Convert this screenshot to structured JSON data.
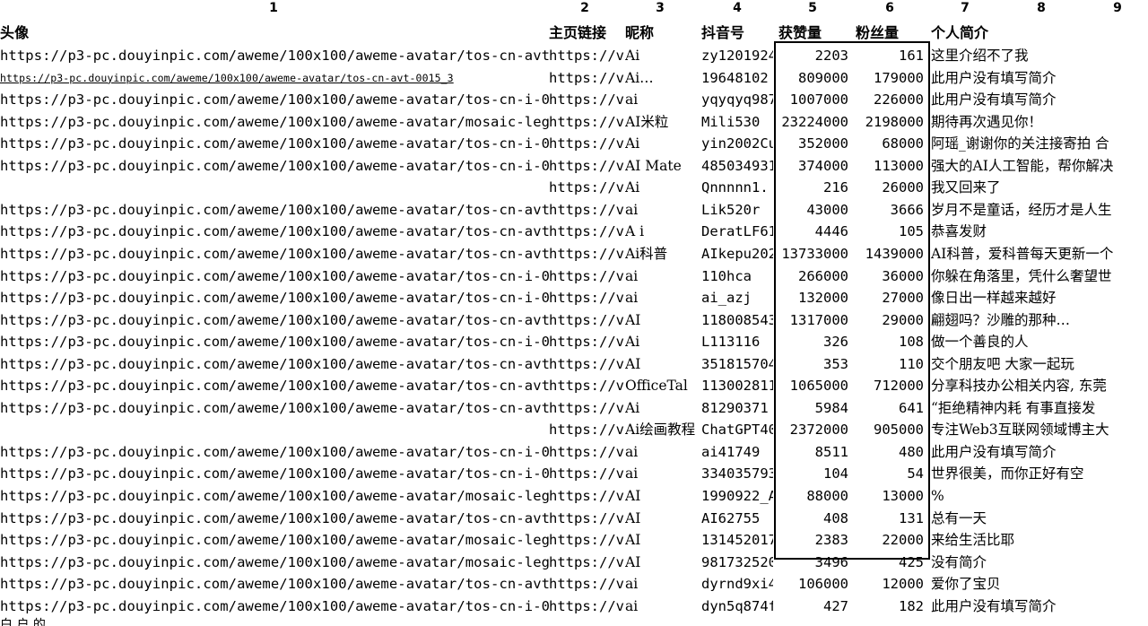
{
  "column_numbers": [
    "1",
    "2",
    "3",
    "4",
    "5",
    "6",
    "7",
    "8",
    "9"
  ],
  "headers": {
    "avatar": "头像",
    "homepage": "主页链接",
    "nickname": "昵称",
    "douyin_id": "抖音号",
    "likes": "获赞量",
    "followers": "粉丝量",
    "bio": "个人简介"
  },
  "rows": [
    {
      "avatar": "https://p3-pc.douyinpic.com/aweme/100x100/aweme-avatar/tos-cn-avt-0015_3",
      "homepage": "https://v",
      "nickname": "Ai",
      "douyin_id": "zy1201924",
      "likes": "2203",
      "followers": "161",
      "bio": "这里介绍不了我"
    },
    {
      "avatar": "https://p3-pc.douyinpic.com/aweme/100x100/aweme-avatar/tos-cn-avt-0015_3",
      "homepage": "https://v",
      "nickname": "Ai…",
      "douyin_id": "19648102",
      "likes": "809000",
      "followers": "179000",
      "bio": "此用户没有填写简介"
    },
    {
      "avatar": "https://p3-pc.douyinpic.com/aweme/100x100/aweme-avatar/tos-cn-i-0813",
      "homepage": "https://v",
      "nickname": "ai",
      "douyin_id": "yqyqyq987",
      "likes": "1007000",
      "followers": "226000",
      "bio": "此用户没有填写简介"
    },
    {
      "avatar": "https://p3-pc.douyinpic.com/aweme/100x100/aweme-avatar/mosaic-legacy",
      "homepage": "https://v",
      "nickname": "AI米粒",
      "douyin_id": "Mili530",
      "likes": "23224000",
      "followers": "2198000",
      "bio": "期待再次遇见你！"
    },
    {
      "avatar": "https://p3-pc.douyinpic.com/aweme/100x100/aweme-avatar/tos-cn-i-0813",
      "homepage": "https://v",
      "nickname": "Ai",
      "douyin_id": "yin2002Cu",
      "likes": "352000",
      "followers": "68000",
      "bio": "阿瑶_谢谢你的关注接寄拍 合"
    },
    {
      "avatar": "https://p3-pc.douyinpic.com/aweme/100x100/aweme-avatar/tos-cn-i-0813",
      "homepage": "https://v",
      "nickname": "AI Mate",
      "douyin_id": "485034931",
      "likes": "374000",
      "followers": "113000",
      "bio": "强大的AI人工智能，帮你解决"
    },
    {
      "avatar": "",
      "homepage": "https://v",
      "nickname": "Ai",
      "douyin_id": "Qnnnnn1.",
      "likes": "216",
      "followers": "26000",
      "bio": "我又回来了"
    },
    {
      "avatar": "https://p3-pc.douyinpic.com/aweme/100x100/aweme-avatar/tos-cn-avt-0015",
      "homepage": "https://v",
      "nickname": "ai",
      "douyin_id": "Lik520r",
      "likes": "43000",
      "followers": "3666",
      "bio": "岁月不是童话，经历才是人生"
    },
    {
      "avatar": "https://p3-pc.douyinpic.com/aweme/100x100/aweme-avatar/tos-cn-avt-0015",
      "homepage": "https://v",
      "nickname": "A i",
      "douyin_id": "DeratLF61",
      "likes": "4446",
      "followers": "105",
      "bio": "恭喜发财"
    },
    {
      "avatar": "https://p3-pc.douyinpic.com/aweme/100x100/aweme-avatar/tos-cn-avt-0015",
      "homepage": "https://v",
      "nickname": "Ai科普",
      "douyin_id": "AIkepu202",
      "likes": "13733000",
      "followers": "1439000",
      "bio": "AI科普，爱科普每天更新一个"
    },
    {
      "avatar": "https://p3-pc.douyinpic.com/aweme/100x100/aweme-avatar/tos-cn-i-0813",
      "homepage": "https://v",
      "nickname": "ai",
      "douyin_id": "110hca",
      "likes": "266000",
      "followers": "36000",
      "bio": "你躲在角落里，凭什么奢望世"
    },
    {
      "avatar": "https://p3-pc.douyinpic.com/aweme/100x100/aweme-avatar/tos-cn-i-0813",
      "homepage": "https://v",
      "nickname": "ai",
      "douyin_id": "ai_azj",
      "likes": "132000",
      "followers": "27000",
      "bio": "像日出一样越来越好"
    },
    {
      "avatar": "https://p3-pc.douyinpic.com/aweme/100x100/aweme-avatar/tos-cn-avt-0015",
      "homepage": "https://v",
      "nickname": "AI",
      "douyin_id": "118008543",
      "likes": "1317000",
      "followers": "29000",
      "bio": "翩翅吗？沙雕的那种…"
    },
    {
      "avatar": "https://p3-pc.douyinpic.com/aweme/100x100/aweme-avatar/tos-cn-i-0813",
      "homepage": "https://v",
      "nickname": "Ai",
      "douyin_id": "L113116",
      "likes": "326",
      "followers": "108",
      "bio": "做一个善良的人"
    },
    {
      "avatar": "https://p3-pc.douyinpic.com/aweme/100x100/aweme-avatar/tos-cn-avt-0015",
      "homepage": "https://v",
      "nickname": "AI",
      "douyin_id": "351815704",
      "likes": "353",
      "followers": "110",
      "bio": "交个朋友吧 大家一起玩"
    },
    {
      "avatar": "https://p3-pc.douyinpic.com/aweme/100x100/aweme-avatar/tos-cn-avt-0015",
      "homepage": "https://v",
      "nickname": "OfficeTal",
      "douyin_id": "113002811",
      "likes": "1065000",
      "followers": "712000",
      "bio": "分享科技办公相关内容, 东莞"
    },
    {
      "avatar": "https://p3-pc.douyinpic.com/aweme/100x100/aweme-avatar/tos-cn-avt-0015",
      "homepage": "https://v",
      "nickname": "Ai",
      "douyin_id": "81290371",
      "likes": "5984",
      "followers": "641",
      "bio": "“拒绝精神内耗 有事直接发"
    },
    {
      "avatar": "",
      "homepage": "https://v",
      "nickname": "Ai绘画教程",
      "douyin_id": "ChatGPT40",
      "likes": "2372000",
      "followers": "905000",
      "bio": "  专注Web3互联网领域博主大"
    },
    {
      "avatar": "https://p3-pc.douyinpic.com/aweme/100x100/aweme-avatar/tos-cn-i-0813",
      "homepage": "https://v",
      "nickname": "ai",
      "douyin_id": "ai41749",
      "likes": "8511",
      "followers": "480",
      "bio": "此用户没有填写简介"
    },
    {
      "avatar": "https://p3-pc.douyinpic.com/aweme/100x100/aweme-avatar/tos-cn-i-0813",
      "homepage": "https://v",
      "nickname": "ai",
      "douyin_id": "334035793",
      "likes": "104",
      "followers": "54",
      "bio": "世界很美，而你正好有空"
    },
    {
      "avatar": "https://p3-pc.douyinpic.com/aweme/100x100/aweme-avatar/mosaic-legacy",
      "homepage": "https://v",
      "nickname": "AI",
      "douyin_id": "1990922_A",
      "likes": "88000",
      "followers": "13000",
      "bio": "%"
    },
    {
      "avatar": "https://p3-pc.douyinpic.com/aweme/100x100/aweme-avatar/tos-cn-avt-0015",
      "homepage": "https://v",
      "nickname": "AI",
      "douyin_id": "AI62755",
      "likes": "408",
      "followers": "131",
      "bio": "总有一天"
    },
    {
      "avatar": "https://p3-pc.douyinpic.com/aweme/100x100/aweme-avatar/mosaic-legacy",
      "homepage": "https://v",
      "nickname": "AI",
      "douyin_id": "131452017",
      "likes": "2383",
      "followers": "22000",
      "bio": "来给生活比耶"
    },
    {
      "avatar": "https://p3-pc.douyinpic.com/aweme/100x100/aweme-avatar/mosaic-legacy",
      "homepage": "https://v",
      "nickname": "AI",
      "douyin_id": "981732520",
      "likes": "3496",
      "followers": "425",
      "bio": "没有简介"
    },
    {
      "avatar": "https://p3-pc.douyinpic.com/aweme/100x100/aweme-avatar/tos-cn-avt-0015",
      "homepage": "https://v",
      "nickname": "ai",
      "douyin_id": "dyrnd9xi4",
      "likes": "106000",
      "followers": "12000",
      "bio": "爱你了宝贝"
    },
    {
      "avatar": "https://p3-pc.douyinpic.com/aweme/100x100/aweme-avatar/tos-cn-i-0813",
      "homepage": "https://v",
      "nickname": "ai",
      "douyin_id": "dyn5q874f",
      "likes": "427",
      "followers": "182",
      "bio": "此用户没有填写简介"
    }
  ],
  "bottom_fragment": "白 户 的"
}
